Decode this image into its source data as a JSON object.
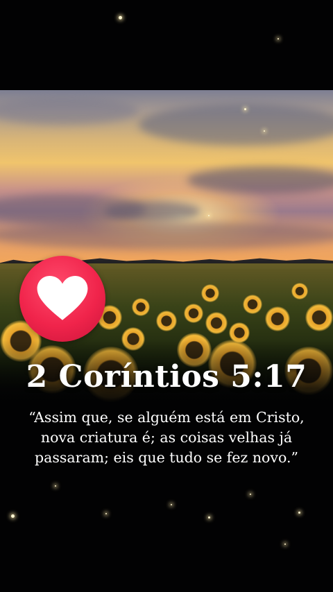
{
  "reference": "2 Coríntios 5:17",
  "verse_text": "“Assim que, se alguém está em Cristo, nova criatura é; as coisas velhas já passaram; eis que tudo se fez novo.”",
  "badge_icon": "heart-icon",
  "colors": {
    "badge": "#f0244b",
    "heart": "#ffffff",
    "background": "#020203"
  }
}
